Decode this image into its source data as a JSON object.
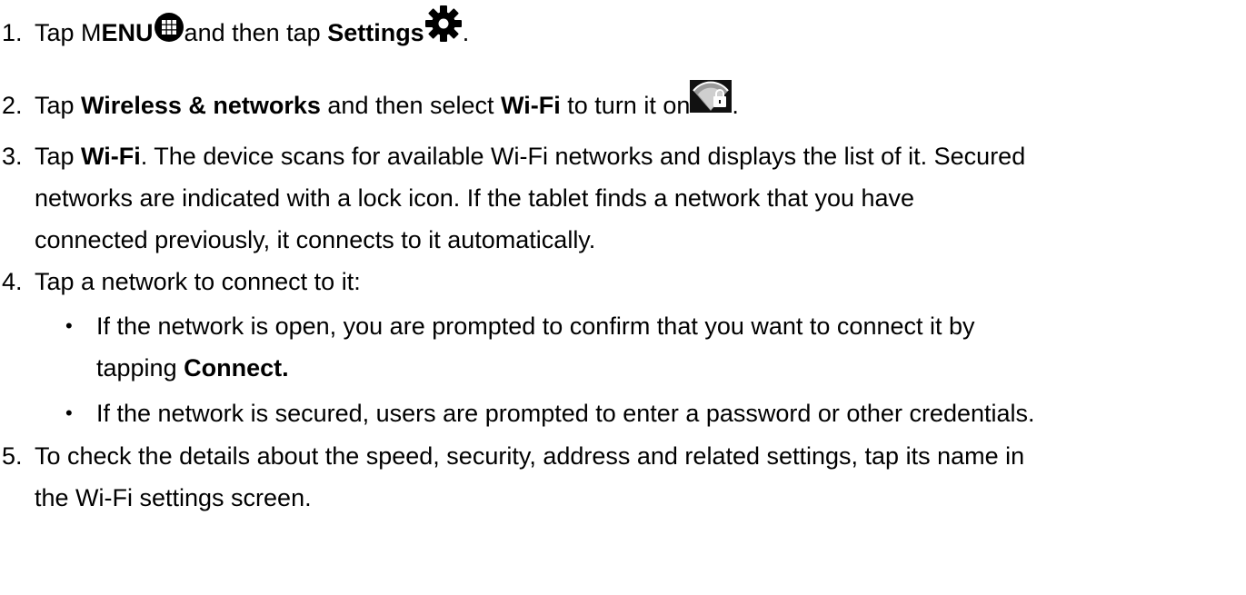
{
  "steps": [
    {
      "num": "1.",
      "a": "Tap M",
      "b": "ENU",
      "c": "and then tap ",
      "d": "Settings",
      "e": "."
    },
    {
      "num": "2.",
      "a": "Tap ",
      "b": "Wireless & networks",
      "c": " and then select ",
      "d": "Wi-Fi",
      "e": " to turn it on",
      "f": "."
    },
    {
      "num": "3.",
      "a": "Tap ",
      "b": "Wi-Fi",
      "c": ". The device scans for available Wi-Fi networks and displays the list of it. Secured",
      "line2": "networks are indicated with a lock icon. If the tablet finds a network that you have",
      "line3": "connected previously, it connects to it automatically."
    },
    {
      "num": "4.",
      "a": "Tap a network to connect to it:"
    },
    {
      "num": "5.",
      "a": "To check the details about the speed, security, address and related settings, tap its name in",
      "line2": "the Wi-Fi settings screen."
    }
  ],
  "bullets": [
    {
      "mark": "•",
      "a": "If the network is open, you are prompted to confirm that you want to connect it by",
      "line2a": "tapping ",
      "line2b": "Connect."
    },
    {
      "mark": "•",
      "a": "If the network is secured, users are prompted to enter a password or other credentials."
    }
  ],
  "icons": {
    "menu": "menu-grid-icon",
    "settings": "gear-icon",
    "wifi": "wifi-lock-icon"
  }
}
